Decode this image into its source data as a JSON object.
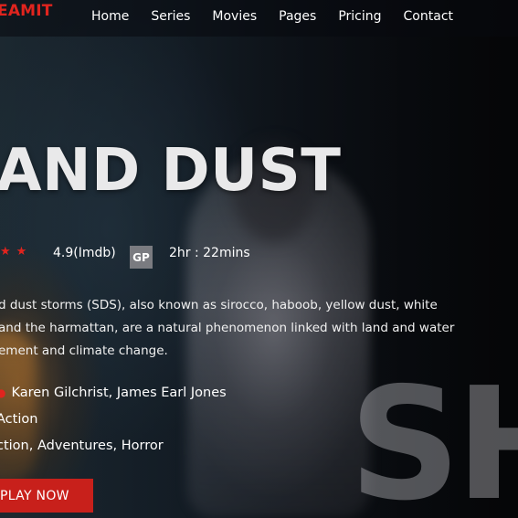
{
  "brand": {
    "name": "EAMIT",
    "color": "#e0241e"
  },
  "nav": {
    "items": [
      {
        "label": "Home"
      },
      {
        "label": "Series"
      },
      {
        "label": "Movies"
      },
      {
        "label": "Pages"
      },
      {
        "label": "Pricing"
      },
      {
        "label": "Contact"
      }
    ]
  },
  "hero": {
    "title": "AND DUST",
    "stars_icon": "star-icon",
    "rating": "4.9(Imdb)",
    "badge": "GP",
    "duration": "2hr : 22mins",
    "description": {
      "lines": [
        "d dust storms (SDS), also known as sirocco, haboob, yellow dust, white",
        "and the harmattan, are a natural phenomenon linked with land and water",
        "ement and climate change."
      ]
    },
    "cast": "Karen Gilchrist, James Earl Jones",
    "genre": "Action",
    "tags": "ction, Adventures, Horror",
    "play_label": "PLAY NOW",
    "background_letters": "SH"
  },
  "colors": {
    "accent": "#e0241e",
    "button": "#c8201b",
    "badge_bg": "#7a7b80"
  }
}
